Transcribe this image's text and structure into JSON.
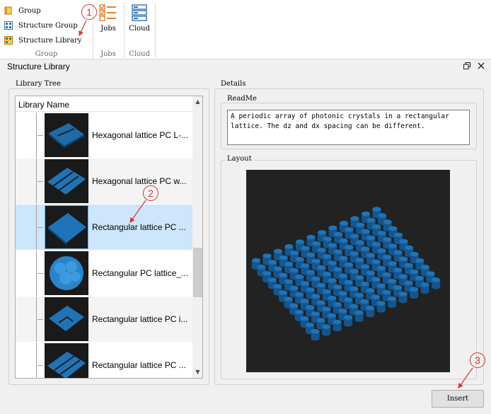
{
  "ribbon": {
    "items": [
      {
        "label": "Group",
        "icon": "group-icon"
      },
      {
        "label": "Structure Group",
        "icon": "structure-group-icon"
      },
      {
        "label": "Structure Library",
        "icon": "structure-library-icon"
      }
    ],
    "group_caption": "Group",
    "jobs": {
      "label": "Jobs",
      "caption": "Jobs",
      "icon": "jobs-icon"
    },
    "cloud": {
      "label": "Cloud",
      "caption": "Cloud",
      "icon": "cloud-server-icon"
    }
  },
  "dialog": {
    "title": "Structure Library",
    "restore_icon": "restore-icon",
    "close_icon": "close-icon",
    "library_tree": {
      "label": "Library Tree",
      "header": "Library Name",
      "items": [
        {
          "label": "Hexagonal lattice PC L-..."
        },
        {
          "label": "Hexagonal lattice PC w..."
        },
        {
          "label": "Rectangular lattice PC ...",
          "selected": true
        },
        {
          "label": "Rectangular PC lattice_..."
        },
        {
          "label": "Rectangular lattice PC i..."
        },
        {
          "label": "Rectangular lattice PC ..."
        }
      ]
    },
    "details": {
      "label": "Details",
      "readme_label": "ReadMe",
      "readme_text": "A periodic array of photonic crystals in a rectangular lattice. The dz and dx spacing can be different.",
      "layout_label": "Layout"
    },
    "insert_label": "Insert"
  },
  "callouts": [
    "1",
    "2",
    "3"
  ],
  "colors": {
    "accent": "#e03030",
    "selection": "#cde6fb",
    "pillar": "#1f74b8"
  }
}
